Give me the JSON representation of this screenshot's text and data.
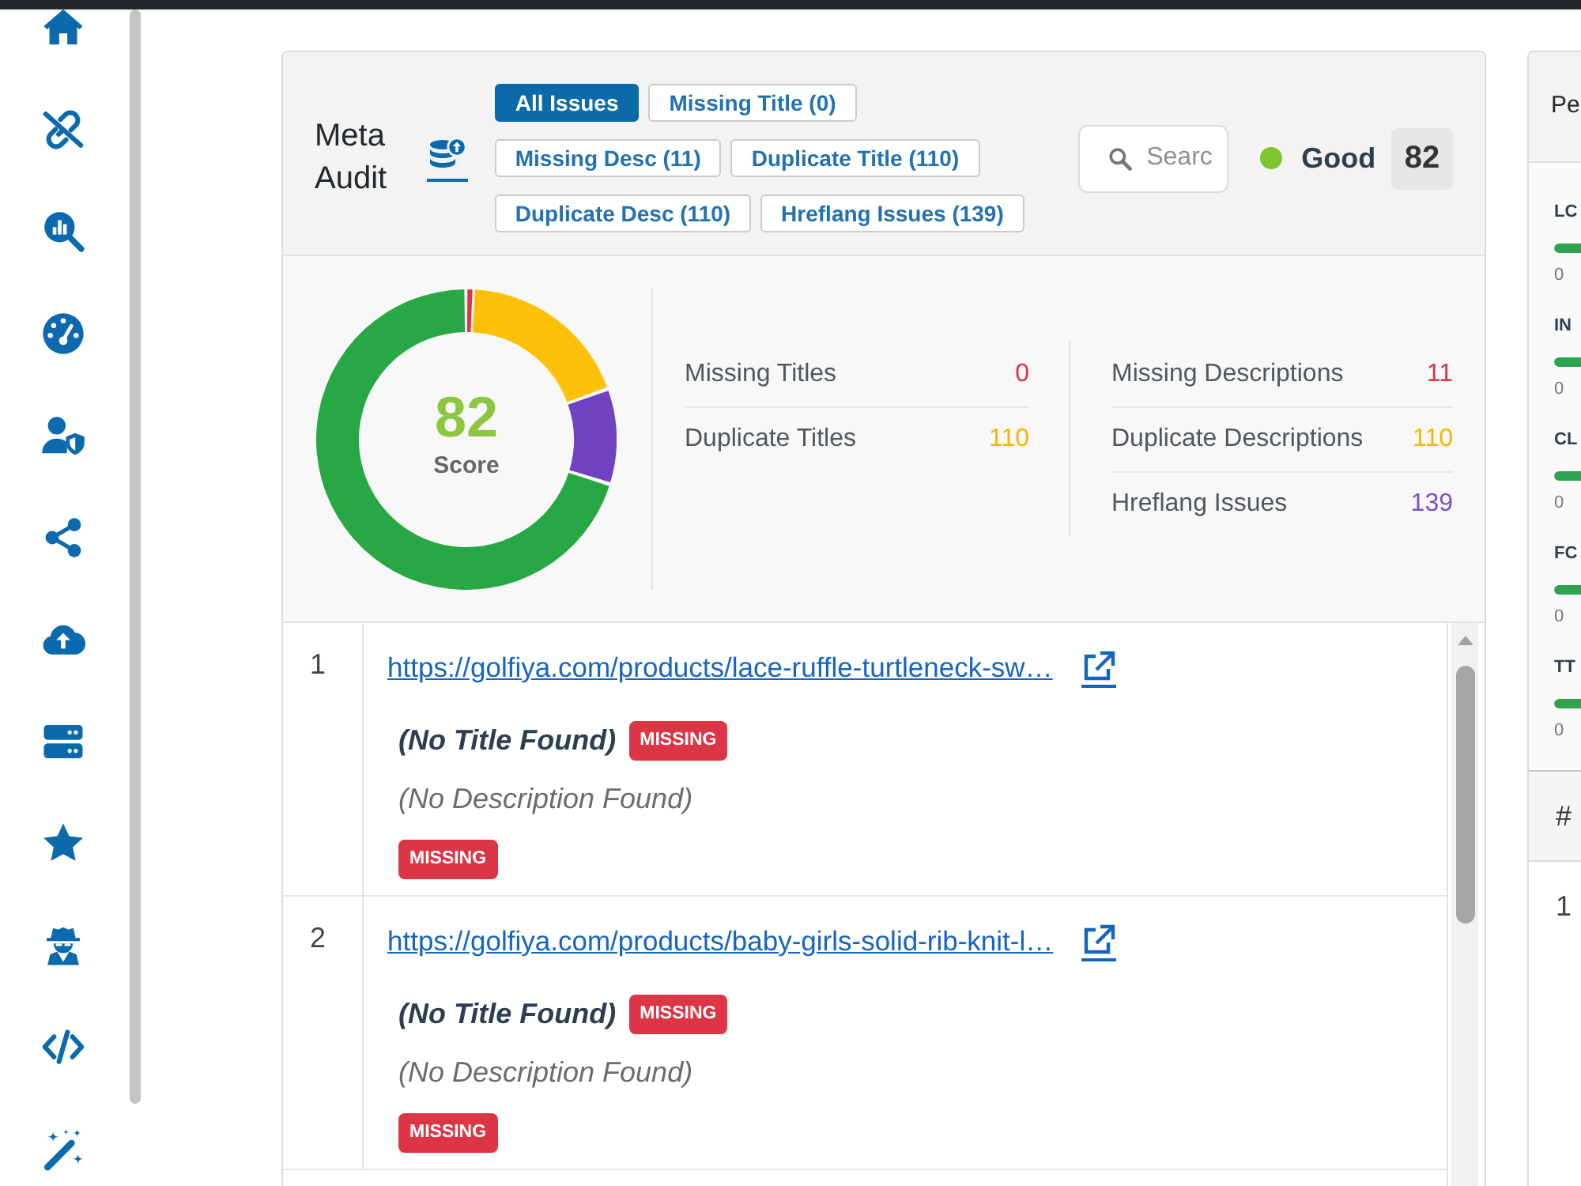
{
  "meta_audit": {
    "title": "Meta Audit",
    "filters": [
      {
        "label": "All Issues",
        "selected": true
      },
      {
        "label": "Missing Title (0)",
        "selected": false
      },
      {
        "label": "Missing Desc (11)",
        "selected": false
      },
      {
        "label": "Duplicate Title (110)",
        "selected": false
      },
      {
        "label": "Duplicate Desc (110)",
        "selected": false
      },
      {
        "label": "Hreflang Issues (139)",
        "selected": false
      }
    ],
    "search": {
      "placeholder": "Searc"
    },
    "status": {
      "label": "Good",
      "score": "82"
    }
  },
  "summary": {
    "score": "82",
    "score_label": "Score",
    "stat_columns": [
      {
        "stats": [
          {
            "label": "Missing Titles",
            "value": "0",
            "color": "#dc3545"
          },
          {
            "label": "Duplicate Titles",
            "value": "110",
            "color": "#f5b800"
          }
        ]
      },
      {
        "stats": [
          {
            "label": "Missing Descriptions",
            "value": "11",
            "color": "#dc3545"
          },
          {
            "label": "Duplicate Descriptions",
            "value": "110",
            "color": "#f5b800"
          },
          {
            "label": "Hreflang Issues",
            "value": "139",
            "color": "#7b4fc9"
          }
        ]
      }
    ]
  },
  "table": {
    "rows": [
      {
        "number": "1",
        "url": "https://golfiya.com/products/lace-ruffle-turtleneck-sw…",
        "title": "(No Title Found)",
        "title_badge": "MISSING",
        "description": "(No Description Found)",
        "description_badge": "MISSING"
      },
      {
        "number": "2",
        "url": "https://golfiya.com/products/baby-girls-solid-rib-knit-l…",
        "title": "(No Title Found)",
        "title_badge": "MISSING",
        "description": "(No Description Found)",
        "description_badge": "MISSING"
      }
    ]
  },
  "side_panel": {
    "title": "Pe",
    "metrics": [
      {
        "label": "LC",
        "level": 1,
        "reading": "0"
      },
      {
        "label": "IN",
        "level": 1,
        "reading": "0"
      },
      {
        "label": "CL",
        "level": 1,
        "reading": "0"
      },
      {
        "label": "FC",
        "level": 1,
        "reading": "0"
      },
      {
        "label": "TT",
        "level": 1,
        "reading": "0"
      }
    ],
    "table": {
      "columns": [
        "#"
      ],
      "rows": [
        {
          "cells": [
            "1"
          ]
        }
      ]
    }
  }
}
